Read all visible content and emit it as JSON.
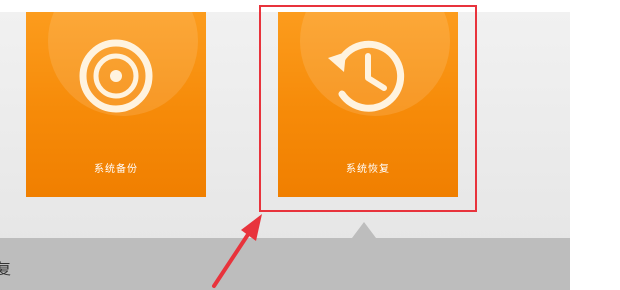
{
  "tiles": [
    {
      "label": "系统备份",
      "icon": "disc-icon"
    },
    {
      "label": "系统恢复",
      "icon": "restore-clock-icon"
    }
  ],
  "bottom_bar": {
    "text": "复"
  },
  "colors": {
    "tile_orange": "#f68a08",
    "highlight_red": "#e8333c",
    "panel_gray": "#e6e6e6",
    "bar_gray": "#bdbdbd"
  }
}
